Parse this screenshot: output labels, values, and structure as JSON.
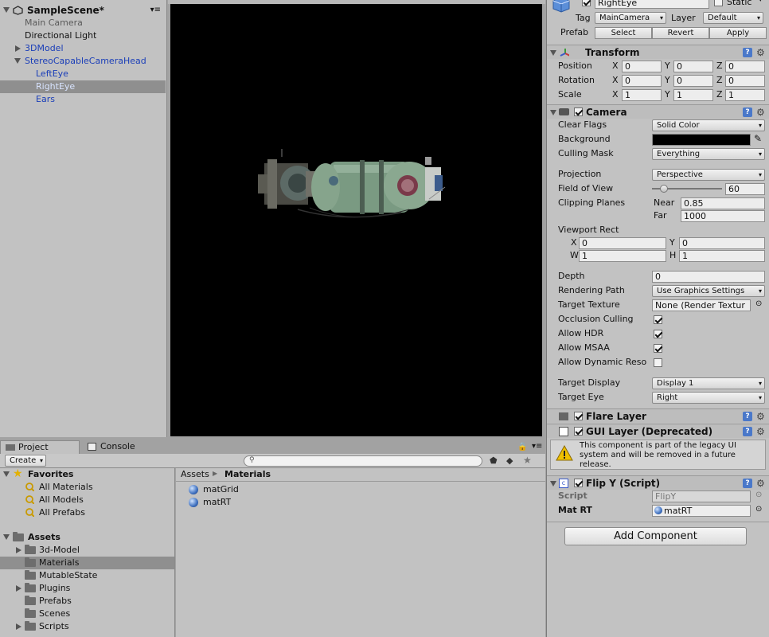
{
  "hierarchy": {
    "scene_name": "SampleScene*",
    "items": [
      {
        "label": "Main Camera"
      },
      {
        "label": "Directional Light"
      },
      {
        "label": "3DModel"
      },
      {
        "label": "StereoCapableCameraHead"
      },
      {
        "label": "LeftEye"
      },
      {
        "label": "RightEye"
      },
      {
        "label": "Ears"
      }
    ]
  },
  "project": {
    "tabs": [
      {
        "label": "Project"
      },
      {
        "label": "Console"
      }
    ],
    "create_label": "Create",
    "search_placeholder": "",
    "favorites": {
      "label": "Favorites",
      "items": [
        {
          "label": "All Materials"
        },
        {
          "label": "All Models"
        },
        {
          "label": "All Prefabs"
        }
      ]
    },
    "assets": {
      "label": "Assets",
      "folders": [
        {
          "label": "3d-Model"
        },
        {
          "label": "Materials"
        },
        {
          "label": "MutableState"
        },
        {
          "label": "Plugins"
        },
        {
          "label": "Prefabs"
        },
        {
          "label": "Scenes"
        },
        {
          "label": "Scripts"
        }
      ]
    },
    "breadcrumb": {
      "root": "Assets",
      "current": "Materials"
    },
    "files": [
      {
        "label": "matGrid"
      },
      {
        "label": "matRT"
      }
    ]
  },
  "inspector": {
    "object_name": "RightEye",
    "static_label": "Static",
    "tag_label": "Tag",
    "tag_value": "MainCamera",
    "layer_label": "Layer",
    "layer_value": "Default",
    "prefab_label": "Prefab",
    "prefab_buttons": [
      "Select",
      "Revert",
      "Apply"
    ],
    "transform": {
      "title": "Transform",
      "position_label": "Position",
      "rotation_label": "Rotation",
      "scale_label": "Scale",
      "axis": [
        "X",
        "Y",
        "Z"
      ],
      "position": [
        "0",
        "0",
        "0"
      ],
      "rotation": [
        "0",
        "0",
        "0"
      ],
      "scale": [
        "1",
        "1",
        "1"
      ]
    },
    "camera": {
      "title": "Camera",
      "clear_flags_label": "Clear Flags",
      "clear_flags_value": "Solid Color",
      "background_label": "Background",
      "background_color": "#000000",
      "culling_mask_label": "Culling Mask",
      "culling_mask_value": "Everything",
      "projection_label": "Projection",
      "projection_value": "Perspective",
      "fov_label": "Field of View",
      "fov_value": "60",
      "fov_fraction": 0.17,
      "clipping_label": "Clipping Planes",
      "near_label": "Near",
      "near_value": "0.85",
      "far_label": "Far",
      "far_value": "1000",
      "viewport_label": "Viewport Rect",
      "vp_x_label": "X",
      "vp_x": "0",
      "vp_y_label": "Y",
      "vp_y": "0",
      "vp_w_label": "W",
      "vp_w": "1",
      "vp_h_label": "H",
      "vp_h": "1",
      "depth_label": "Depth",
      "depth_value": "0",
      "rendering_path_label": "Rendering Path",
      "rendering_path_value": "Use Graphics Settings",
      "target_texture_label": "Target Texture",
      "target_texture_value": "None (Render Textur",
      "occlusion_label": "Occlusion Culling",
      "hdr_label": "Allow HDR",
      "msaa_label": "Allow MSAA",
      "dynres_label": "Allow Dynamic Reso",
      "target_display_label": "Target Display",
      "target_display_value": "Display 1",
      "target_eye_label": "Target Eye",
      "target_eye_value": "Right"
    },
    "flare_layer": {
      "title": "Flare Layer"
    },
    "gui_layer": {
      "title": "GUI Layer (Deprecated)",
      "warning_line1": "This component is part of the legacy UI",
      "warning_line2": "system and will be removed in a future",
      "warning_line3": "release."
    },
    "flip_y": {
      "title": "Flip Y (Script)",
      "script_label": "Script",
      "script_value": "FlipY",
      "mat_label": "Mat RT",
      "mat_value": "matRT"
    },
    "add_component_label": "Add Component"
  },
  "colors": {
    "accent_blue": "#1a3eb8",
    "selection": "#8f8f8f",
    "panel": "#c2c2c2"
  }
}
